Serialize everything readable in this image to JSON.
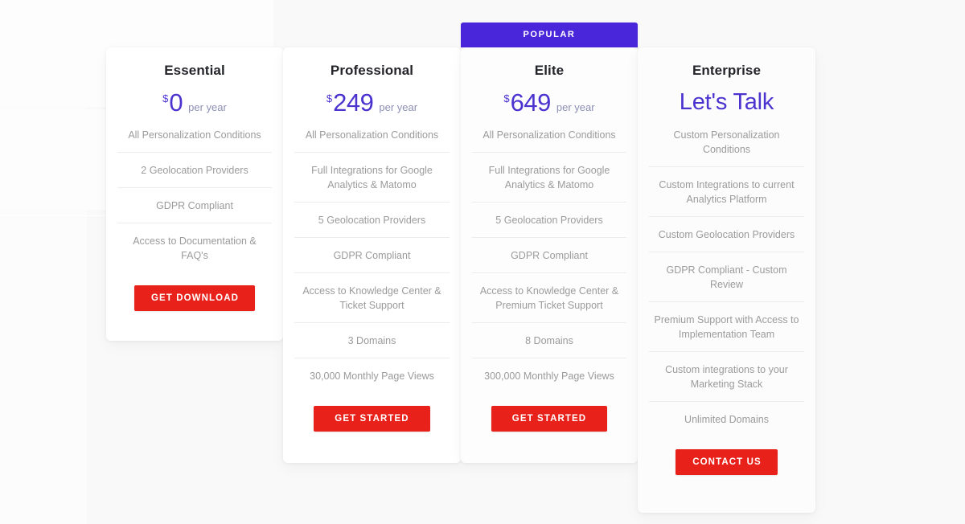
{
  "theme": {
    "accent_purple": "#4a26db",
    "price_purple": "#4a33cf",
    "cta_red": "#e8211a",
    "feature_gray": "#9b9b9b",
    "heading_dark": "#24252a",
    "page_background": "#f9f9f9"
  },
  "badge": {
    "popular_label": "POPULAR"
  },
  "plans": [
    {
      "id": "essential",
      "name": "Essential",
      "currency_symbol": "$",
      "price": "0",
      "period": "per year",
      "features": [
        "All Personalization Conditions",
        "2 Geolocation Providers",
        "GDPR Compliant",
        "Access to Documentation & FAQ's"
      ],
      "cta_label": "GET DOWNLOAD",
      "highlighted": false
    },
    {
      "id": "professional",
      "name": "Professional",
      "currency_symbol": "$",
      "price": "249",
      "period": "per year",
      "features": [
        "All Personalization Conditions",
        "Full Integrations for Google Analytics & Matomo",
        "5 Geolocation Providers",
        "GDPR Compliant",
        "Access to Knowledge Center & Ticket Support",
        "3 Domains",
        "30,000 Monthly Page Views"
      ],
      "cta_label": "GET STARTED",
      "highlighted": false
    },
    {
      "id": "elite",
      "name": "Elite",
      "currency_symbol": "$",
      "price": "649",
      "period": "per year",
      "features": [
        "All Personalization Conditions",
        "Full Integrations for Google Analytics & Matomo",
        "5 Geolocation Providers",
        "GDPR Compliant",
        "Access to Knowledge Center & Premium Ticket Support",
        "8 Domains",
        "300,000 Monthly Page Views"
      ],
      "cta_label": "GET STARTED",
      "highlighted": true
    },
    {
      "id": "enterprise",
      "name": "Enterprise",
      "price_text": "Let's Talk",
      "features": [
        "Custom Personalization Conditions",
        "Custom Integrations to current Analytics Platform",
        "Custom Geolocation Providers",
        "GDPR Compliant - Custom Review",
        "Premium Support with Access to Implementation Team",
        "Custom integrations to your Marketing Stack",
        "Unlimited Domains"
      ],
      "cta_label": "CONTACT US",
      "highlighted": false
    }
  ]
}
